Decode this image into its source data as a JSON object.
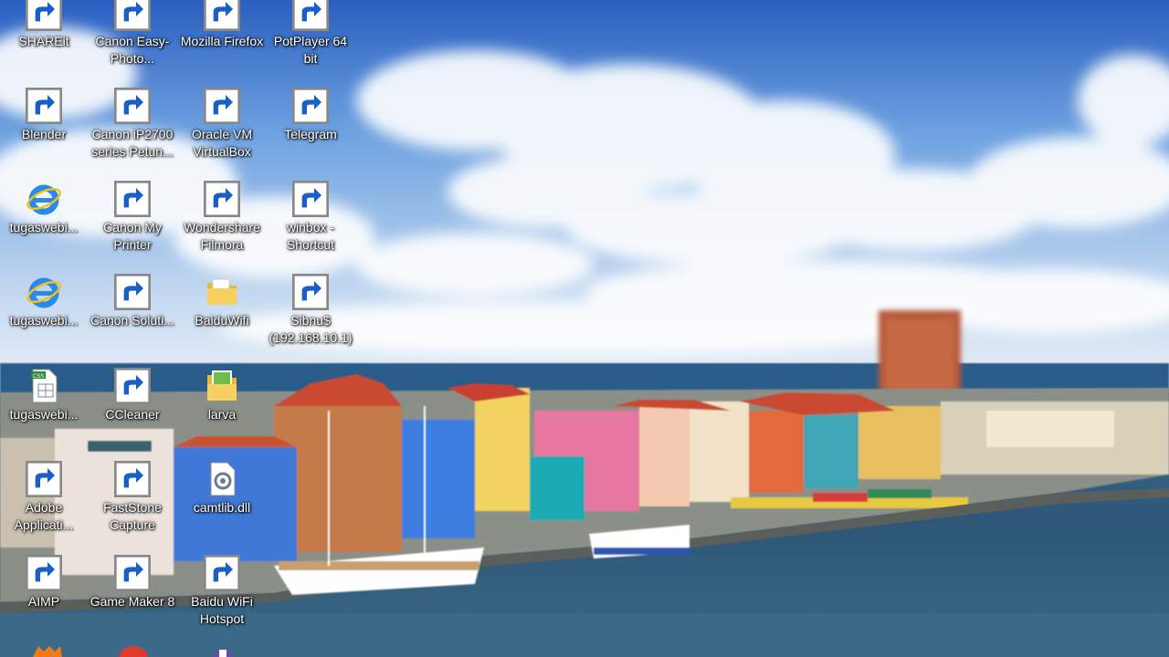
{
  "desktop": {
    "icons": [
      {
        "key": "shareit",
        "label": "SHAREit",
        "icon": "shareit-icon",
        "shortcut": true
      },
      {
        "key": "canon-easy-photo",
        "label": "Canon Easy-Photo...",
        "icon": "canon-easy-photoprint-icon",
        "shortcut": true
      },
      {
        "key": "mozilla-firefox",
        "label": "Mozilla Firefox",
        "icon": "firefox-icon",
        "shortcut": true
      },
      {
        "key": "potplayer",
        "label": "PotPlayer 64 bit",
        "icon": "potplayer-icon",
        "shortcut": true
      },
      {
        "key": "blender",
        "label": "Blender",
        "icon": "blender-icon",
        "shortcut": true
      },
      {
        "key": "canon-ip2700",
        "label": "Canon iP2700 series Petun...",
        "icon": "printer-manual-icon",
        "shortcut": true
      },
      {
        "key": "virtualbox",
        "label": "Oracle VM VirtualBox",
        "icon": "virtualbox-icon",
        "shortcut": true
      },
      {
        "key": "telegram",
        "label": "Telegram",
        "icon": "telegram-icon",
        "shortcut": true
      },
      {
        "key": "tugasweb-1",
        "label": "tugaswebi...",
        "icon": "internet-explorer-icon",
        "shortcut": false
      },
      {
        "key": "canon-my-printer",
        "label": "Canon My Printer",
        "icon": "canon-my-printer-icon",
        "shortcut": true
      },
      {
        "key": "filmora",
        "label": "Wondershare Filmora",
        "icon": "filmora-icon",
        "shortcut": true
      },
      {
        "key": "winbox",
        "label": "winbox - Shortcut",
        "icon": "winbox-icon",
        "shortcut": true
      },
      {
        "key": "tugasweb-2",
        "label": "tugaswebi...",
        "icon": "internet-explorer-icon",
        "shortcut": false
      },
      {
        "key": "canon-solution",
        "label": "Canon Soluti...",
        "icon": "canon-solution-menu-icon",
        "shortcut": true
      },
      {
        "key": "baiduwifi-folder",
        "label": "BaiduWifi",
        "icon": "folder-icon",
        "shortcut": false
      },
      {
        "key": "sibnus",
        "label": "Sibnu$ (192.168.10.1)",
        "icon": "network-folder-icon",
        "shortcut": true
      },
      {
        "key": "tugasweb-css",
        "label": "tugaswebi...",
        "icon": "css-file-icon",
        "shortcut": false
      },
      {
        "key": "ccleaner",
        "label": "CCleaner",
        "icon": "ccleaner-icon",
        "shortcut": true
      },
      {
        "key": "larva",
        "label": "larva",
        "icon": "image-folder-icon",
        "shortcut": false
      },
      {
        "key": "adobe",
        "label": "Adobe Applicati...",
        "icon": "adobe-icon",
        "shortcut": true
      },
      {
        "key": "faststone",
        "label": "FastStone Capture",
        "icon": "faststone-capture-icon",
        "shortcut": true
      },
      {
        "key": "camtlib",
        "label": "camtlib.dll",
        "icon": "dll-file-icon",
        "shortcut": false
      },
      {
        "key": "aimp",
        "label": "AIMP",
        "icon": "aimp-icon",
        "shortcut": true
      },
      {
        "key": "game-maker",
        "label": "Game Maker 8",
        "icon": "game-maker-icon",
        "shortcut": true
      },
      {
        "key": "baidu-wifi-hotspot",
        "label": "Baidu WiFi Hotspot",
        "icon": "baidu-wifi-icon",
        "shortcut": true
      }
    ],
    "partial_icons": [
      "orange-app-icon",
      "red-app-icon",
      "purple-app-icon"
    ]
  },
  "colors": {
    "sky_top": "#2d63c2",
    "sky_mid": "#7fb0e6",
    "horizon": "#dce9f5",
    "sea": "#2e5f88",
    "water": "#3d6c8f"
  }
}
